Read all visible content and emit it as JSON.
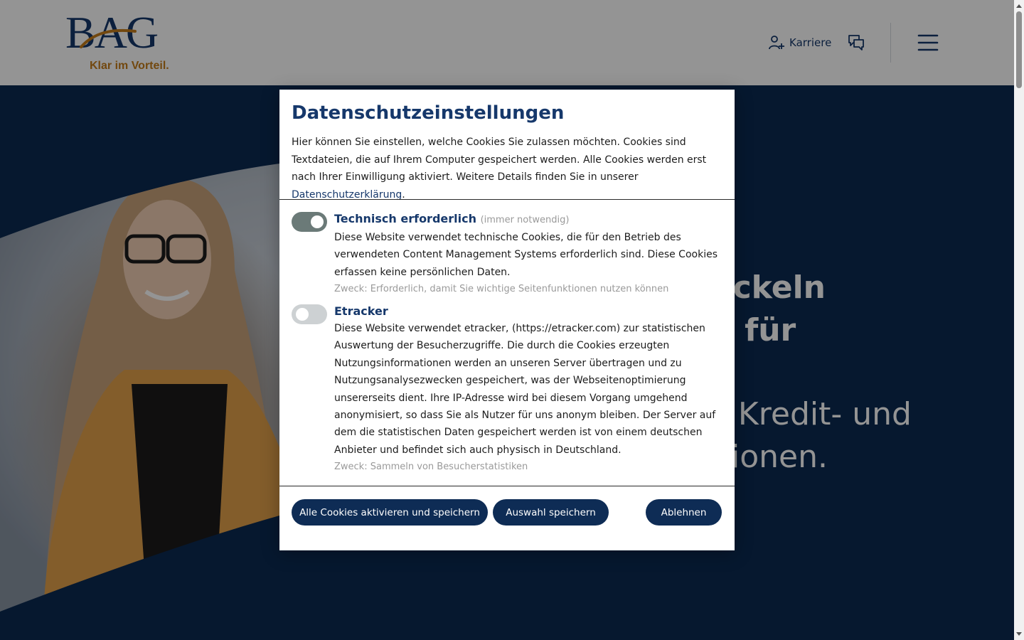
{
  "header": {
    "logo_text": "BAG",
    "logo_tagline": "Klar im Vorteil.",
    "nav_karriere": "Karriere",
    "icons": [
      "add-user-icon",
      "chat-icon",
      "hamburger-menu-icon"
    ]
  },
  "hero": {
    "line1": "Wir entwickeln Lösungen für",
    "line2": "besondere Kredit- und Risikopositionen."
  },
  "modal": {
    "title": "Datenschutzeinstellungen",
    "intro": "Hier können Sie einstellen, welche Cookies Sie zulassen möchten. Cookies sind Textdateien, die auf Ihrem Computer gespeichert werden. Alle Cookies werden erst nach Ihrer Einwilligung aktiviert.  Weitere Details finden Sie in unserer ",
    "intro_link": "Datenschutzerklärung",
    "intro_end": ".",
    "options": [
      {
        "title": "Technisch erforderlich",
        "note": "(immer notwendig)",
        "enabled": true,
        "description": "Diese Website verwendet technische Cookies, die für den Betrieb des verwendeten Content Management Systems erforderlich sind. Diese Cookies erfassen keine persönlichen Daten.",
        "purpose": "Zweck: Erforderlich, damit Sie wichtige Seitenfunktionen nutzen können"
      },
      {
        "title": "Etracker",
        "note": "",
        "enabled": false,
        "description": "Diese Website verwendet etracker, (https://etracker.com) zur statistischen Auswertung der Besucherzugriffe. Die durch die Cookies erzeugten Nutzungsinformationen werden an unseren Server übertragen und zu Nutzungsanalysezwecken gespeichert, was der Webseitenoptimierung unsererseits dient. Ihre IP-Adresse wird bei diesem Vorgang umgehend anonymisiert, so dass Sie als Nutzer für uns anonym bleiben. Der Server auf dem die statistischen Daten gespeichert werden ist von einem deutschen Anbieter und befindet sich auch physisch in Deutschland.",
        "purpose": "Zweck: Sammeln von Besucherstatistiken"
      }
    ],
    "buttons": {
      "accept_all": "Alle Cookies aktivieren und speichern",
      "save_selection": "Auswahl speichern",
      "decline": "Ablehnen"
    }
  },
  "colors": {
    "brand_blue": "#16386b",
    "button_blue": "#0e2c55",
    "brand_orange": "#c47c1a",
    "toggle_on": "#6b7a78",
    "toggle_off": "#cdd1d3"
  }
}
